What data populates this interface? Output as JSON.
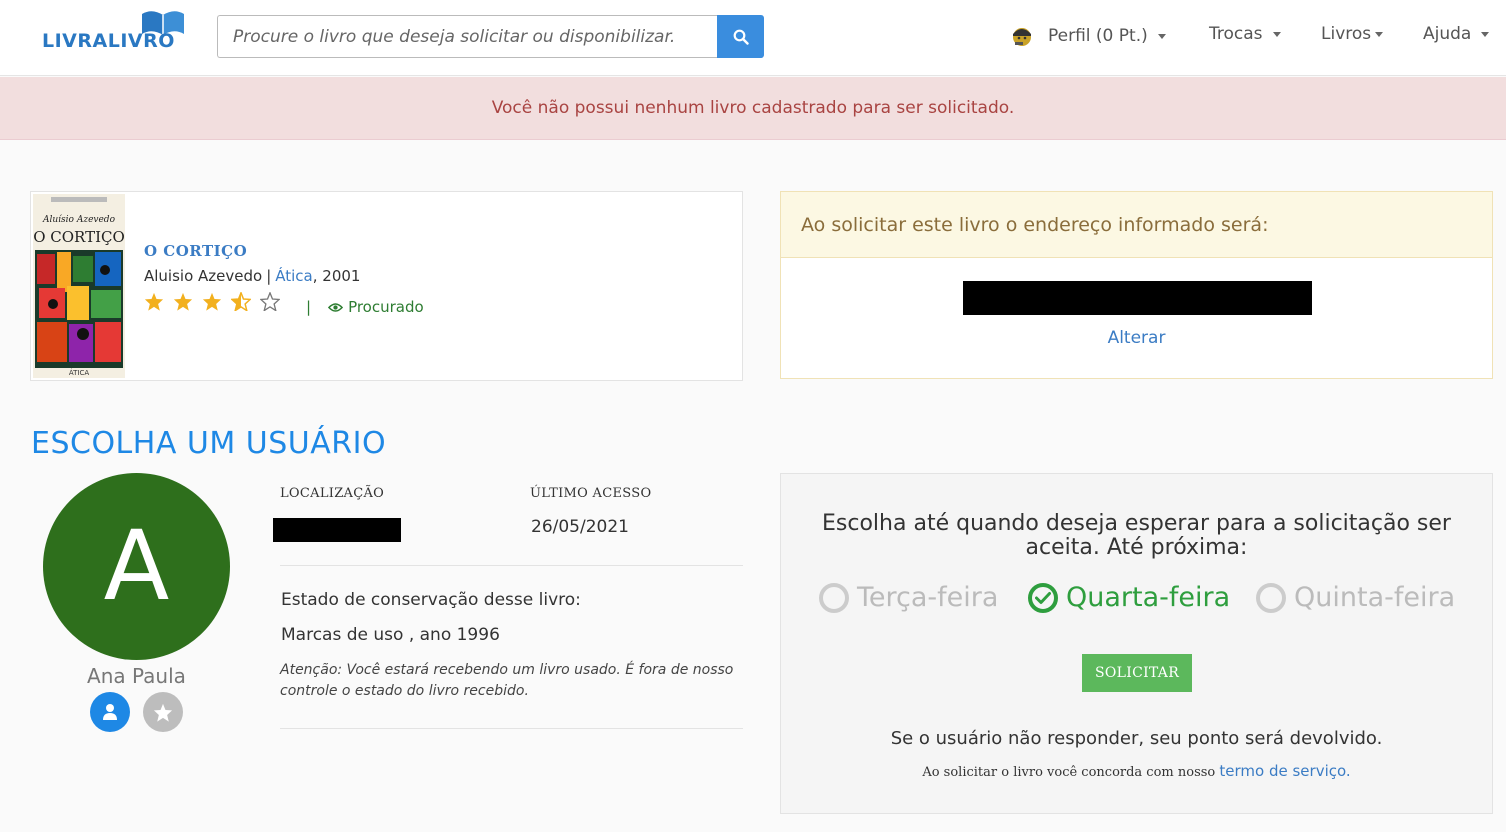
{
  "header": {
    "logo_text": "LIVRALIVRO",
    "search_placeholder": "Procure o livro que deseja solicitar ou disponibilizar.",
    "nav": {
      "perfil": "Perfil (0 Pt.)",
      "trocas": "Trocas",
      "livros": "Livros",
      "ajuda": "Ajuda"
    }
  },
  "alert": {
    "message": "Você não possui nenhum livro cadastrado para ser solicitado."
  },
  "book": {
    "title": "O CORTIÇO",
    "author": "Aluisio Azevedo",
    "publisher": "Ática",
    "year": ", 2001",
    "rating": 3.5,
    "rating_max": 5,
    "status": "Procurado",
    "cover_author": "Aluísio Azevedo",
    "cover_title": "O CORTIÇO"
  },
  "address": {
    "heading": "Ao solicitar este livro o endereço informado será:",
    "change_link": "Alterar"
  },
  "section_title": "ESCOLHA UM USUÁRIO",
  "user": {
    "initial": "A",
    "name": "Ana Paula",
    "avatar_color": "#2e6f1c",
    "location_label": "LOCALIZAÇÃO",
    "last_access_label": "ÚLTIMO ACESSO",
    "last_access": "26/05/2021",
    "condition_label": "Estado de conservação desse livro:",
    "condition": "Marcas de uso , ano 1996",
    "warning": "Atenção: Você estará recebendo um livro usado. É fora de nosso controle o estado do livro recebido."
  },
  "request": {
    "title": "Escolha até quando deseja esperar para a solicitação ser aceita. Até próxima:",
    "options": [
      "Terça-feira",
      "Quarta-feira",
      "Quinta-feira"
    ],
    "selected": "Quarta-feira",
    "button": "SOLICITAR",
    "note": "Se o usuário não responder, seu ponto será devolvido.",
    "terms_text": "Ao solicitar o livro você concorda com nosso",
    "terms_link": "termo de serviço."
  },
  "colors": {
    "accent": "#3a8dde",
    "success": "#2e9e3e",
    "alert_bg": "#f2dede"
  }
}
